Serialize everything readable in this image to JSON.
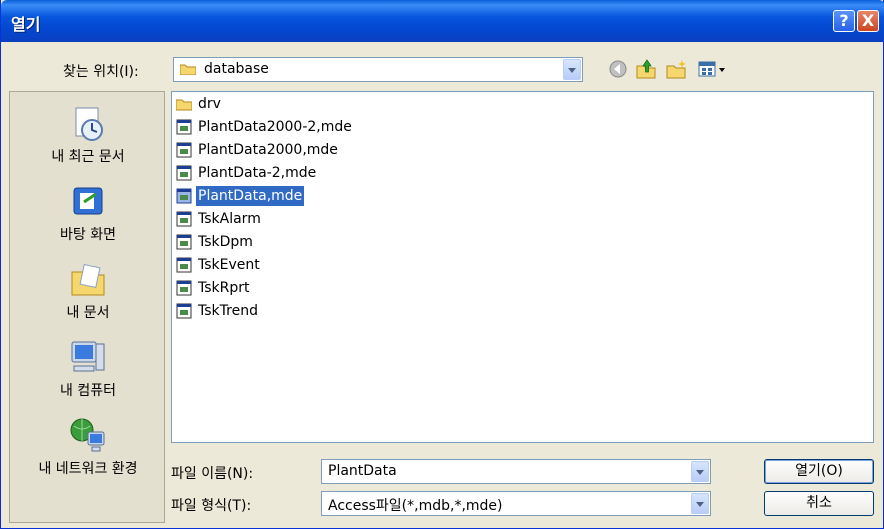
{
  "window": {
    "title": "열기"
  },
  "titlebar": {
    "help_label": "?",
    "close_label": "X"
  },
  "lookin": {
    "label": "찾는 위치(I):",
    "value": "database"
  },
  "toolbar": [
    {
      "name": "back-icon"
    },
    {
      "name": "up-folder-icon"
    },
    {
      "name": "new-folder-icon"
    },
    {
      "name": "views-menu-icon"
    }
  ],
  "places": [
    {
      "label": "내 최근 문서",
      "icon": "recent-documents-icon"
    },
    {
      "label": "바탕 화면",
      "icon": "desktop-icon"
    },
    {
      "label": "내 문서",
      "icon": "my-documents-icon"
    },
    {
      "label": "내 컴퓨터",
      "icon": "my-computer-icon"
    },
    {
      "label": "내 네트워크 환경",
      "icon": "network-places-icon"
    }
  ],
  "files": [
    {
      "name": "drv",
      "type": "folder"
    },
    {
      "name": "PlantData2000-2,mde",
      "type": "mde"
    },
    {
      "name": "PlantData2000,mde",
      "type": "mde"
    },
    {
      "name": "PlantData-2,mde",
      "type": "mde"
    },
    {
      "name": "PlantData,mde",
      "type": "mde",
      "selected": true
    },
    {
      "name": "TskAlarm",
      "type": "mde"
    },
    {
      "name": "TskDpm",
      "type": "mde"
    },
    {
      "name": "TskEvent",
      "type": "mde"
    },
    {
      "name": "TskRprt",
      "type": "mde"
    },
    {
      "name": "TskTrend",
      "type": "mde"
    }
  ],
  "filename": {
    "label": "파일 이름(N):",
    "value": "PlantData"
  },
  "filetype": {
    "label": "파일 형식(T):",
    "value": "Access파일(*,mdb,*,mde)"
  },
  "buttons": {
    "open": "열기(O)",
    "cancel": "취소"
  },
  "colors": {
    "titlebar": "#0855dd",
    "selection": "#316ac5",
    "dialog_bg": "#ece9d8"
  }
}
